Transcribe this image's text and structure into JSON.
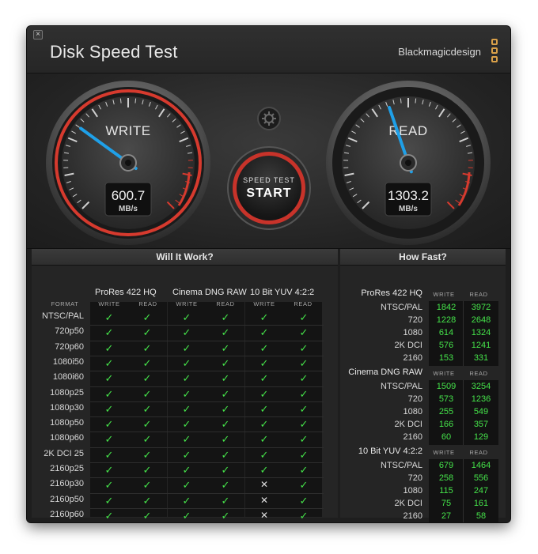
{
  "window": {
    "title": "Disk Speed Test",
    "brand": "Blackmagicdesign",
    "close_label": "×"
  },
  "gauges": {
    "write": {
      "label": "WRITE",
      "value": "600.7",
      "unit": "MB/s",
      "fraction": 0.3
    },
    "read": {
      "label": "READ",
      "value": "1303.2",
      "unit": "MB/s",
      "fraction": 0.43
    }
  },
  "start_button": {
    "top": "SPEED TEST",
    "main": "START"
  },
  "settings_icon": "gear-icon",
  "colors": {
    "accent": "#1fa0e8",
    "ring": "#d63a2e",
    "ok": "#45e34a"
  },
  "will_it_work": {
    "title": "Will It Work?",
    "format_label": "FORMAT",
    "groups": [
      {
        "name": "ProRes 422 HQ",
        "sub": [
          "WRITE",
          "READ"
        ]
      },
      {
        "name": "Cinema DNG RAW",
        "sub": [
          "WRITE",
          "READ"
        ]
      },
      {
        "name": "10 Bit YUV 4:2:2",
        "sub": [
          "WRITE",
          "READ"
        ]
      }
    ],
    "ok_symbol": "✓",
    "no_symbol": "✕",
    "rows": [
      {
        "format": "NTSC/PAL",
        "cells": [
          1,
          1,
          1,
          1,
          1,
          1
        ]
      },
      {
        "format": "720p50",
        "cells": [
          1,
          1,
          1,
          1,
          1,
          1
        ]
      },
      {
        "format": "720p60",
        "cells": [
          1,
          1,
          1,
          1,
          1,
          1
        ]
      },
      {
        "format": "1080i50",
        "cells": [
          1,
          1,
          1,
          1,
          1,
          1
        ]
      },
      {
        "format": "1080i60",
        "cells": [
          1,
          1,
          1,
          1,
          1,
          1
        ]
      },
      {
        "format": "1080p25",
        "cells": [
          1,
          1,
          1,
          1,
          1,
          1
        ]
      },
      {
        "format": "1080p30",
        "cells": [
          1,
          1,
          1,
          1,
          1,
          1
        ]
      },
      {
        "format": "1080p50",
        "cells": [
          1,
          1,
          1,
          1,
          1,
          1
        ]
      },
      {
        "format": "1080p60",
        "cells": [
          1,
          1,
          1,
          1,
          1,
          1
        ]
      },
      {
        "format": "2K DCI 25",
        "cells": [
          1,
          1,
          1,
          1,
          1,
          1
        ]
      },
      {
        "format": "2160p25",
        "cells": [
          1,
          1,
          1,
          1,
          1,
          1
        ]
      },
      {
        "format": "2160p30",
        "cells": [
          1,
          1,
          1,
          1,
          0,
          1
        ]
      },
      {
        "format": "2160p50",
        "cells": [
          1,
          1,
          1,
          1,
          0,
          1
        ]
      },
      {
        "format": "2160p60",
        "cells": [
          1,
          1,
          1,
          1,
          0,
          1
        ]
      }
    ]
  },
  "how_fast": {
    "title": "How Fast?",
    "groups": [
      {
        "name": "ProRes 422 HQ",
        "sub": [
          "WRITE",
          "READ"
        ],
        "rows": [
          {
            "label": "NTSC/PAL",
            "write": "1842",
            "read": "3972"
          },
          {
            "label": "720",
            "write": "1228",
            "read": "2648"
          },
          {
            "label": "1080",
            "write": "614",
            "read": "1324"
          },
          {
            "label": "2K DCI",
            "write": "576",
            "read": "1241"
          },
          {
            "label": "2160",
            "write": "153",
            "read": "331"
          }
        ]
      },
      {
        "name": "Cinema DNG RAW",
        "sub": [
          "WRITE",
          "READ"
        ],
        "rows": [
          {
            "label": "NTSC/PAL",
            "write": "1509",
            "read": "3254"
          },
          {
            "label": "720",
            "write": "573",
            "read": "1236"
          },
          {
            "label": "1080",
            "write": "255",
            "read": "549"
          },
          {
            "label": "2K DCI",
            "write": "166",
            "read": "357"
          },
          {
            "label": "2160",
            "write": "60",
            "read": "129"
          }
        ]
      },
      {
        "name": "10 Bit YUV 4:2:2",
        "sub": [
          "WRITE",
          "READ"
        ],
        "rows": [
          {
            "label": "NTSC/PAL",
            "write": "679",
            "read": "1464"
          },
          {
            "label": "720",
            "write": "258",
            "read": "556"
          },
          {
            "label": "1080",
            "write": "115",
            "read": "247"
          },
          {
            "label": "2K DCI",
            "write": "75",
            "read": "161"
          },
          {
            "label": "2160",
            "write": "27",
            "read": "58"
          }
        ]
      }
    ]
  }
}
